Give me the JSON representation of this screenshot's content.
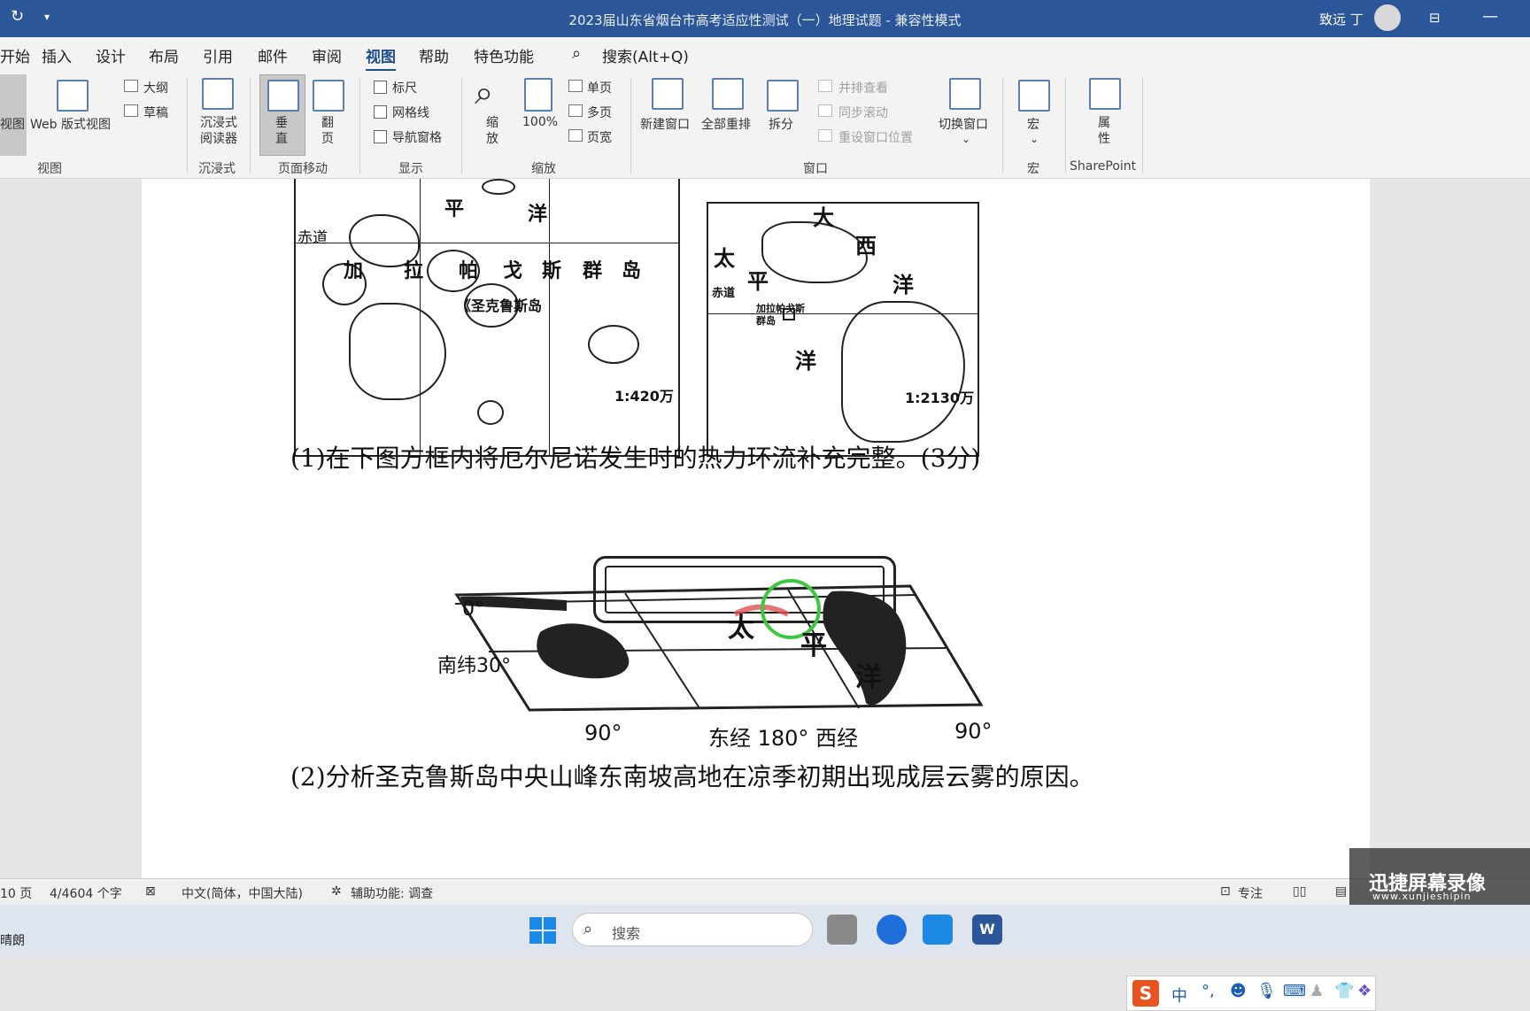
{
  "window": {
    "title": "2023届山东省烟台市高考适应性测试（一）地理试题  -  兼容性模式",
    "user": "致远 丁"
  },
  "menu": {
    "tabs": [
      "开始",
      "插入",
      "设计",
      "布局",
      "引用",
      "邮件",
      "审阅",
      "视图",
      "帮助",
      "特色功能"
    ],
    "active": "视图",
    "search": "搜索(Alt+Q)"
  },
  "ribbon": {
    "view_group": {
      "read_mode": "视图",
      "web_layout": "Web 版式视图",
      "outline": "大纲",
      "draft": "草稿",
      "label": "视图"
    },
    "immersive": {
      "reader": "沉浸式阅读器",
      "label": "沉浸式"
    },
    "page_movement": {
      "vertical": "垂直",
      "side_to_side": "翻页",
      "label": "页面移动"
    },
    "show": {
      "ruler": "标尺",
      "gridlines": "网格线",
      "nav_pane": "导航窗格",
      "label": "显示"
    },
    "zoom": {
      "zoom": "缩放",
      "hundred": "100%",
      "one_page": "单页",
      "multi_page": "多页",
      "page_width": "页宽",
      "label": "缩放"
    },
    "window": {
      "new_window": "新建窗口",
      "arrange_all": "全部重排",
      "split": "拆分",
      "side_by_side": "并排查看",
      "sync_scroll": "同步滚动",
      "reset_position": "重设窗口位置",
      "switch_windows": "切换窗口",
      "label": "窗口"
    },
    "macros": {
      "macros": "宏",
      "label": "宏"
    },
    "sharepoint": {
      "properties": "属性",
      "label": "SharePoint"
    }
  },
  "document": {
    "map_top": {
      "left_labels": {
        "pingyang_ping": "平",
        "pingyang_yang": "洋",
        "equator": "赤道",
        "jia": "加",
        "la": "拉",
        "pa": "帕",
        "ge": "戈",
        "si": "斯",
        "qun": "群",
        "dao": "岛",
        "island": "《圣克鲁斯岛",
        "scale": "1:420万"
      },
      "right_labels": {
        "tai": "太",
        "ping": "平",
        "yang": "洋",
        "da": "大",
        "xi": "西",
        "yang2": "洋",
        "equator": "赤道",
        "islands": "加拉帕戈斯群岛",
        "scale": "1:2130万"
      }
    },
    "question1": "(1)在下图方框内将厄尔尼诺发生时的热力环流补充完整。(3分)",
    "map_bottom": {
      "lat0": "0°",
      "lat30": "南纬30°",
      "tai": "太",
      "ping": "平",
      "yang": "洋",
      "lon_left": "90°",
      "lon_center": "东经  180°  西经",
      "lon_right": "90°"
    },
    "question2": "(2)分析圣克鲁斯岛中央山峰东南坡高地在凉季初期出现成层云雾的原因。"
  },
  "statusbar": {
    "page": "10 页",
    "words": "4/4604 个字",
    "language": "中文(简体，中国大陆)",
    "accessibility": "辅助功能: 调查",
    "focus": "专注"
  },
  "taskbar": {
    "weather": "晴朗",
    "search": "搜索"
  },
  "ime": {
    "mode": "中"
  },
  "watermark": {
    "title": "迅捷屏幕录像",
    "url": "www.xunjieshipin"
  }
}
